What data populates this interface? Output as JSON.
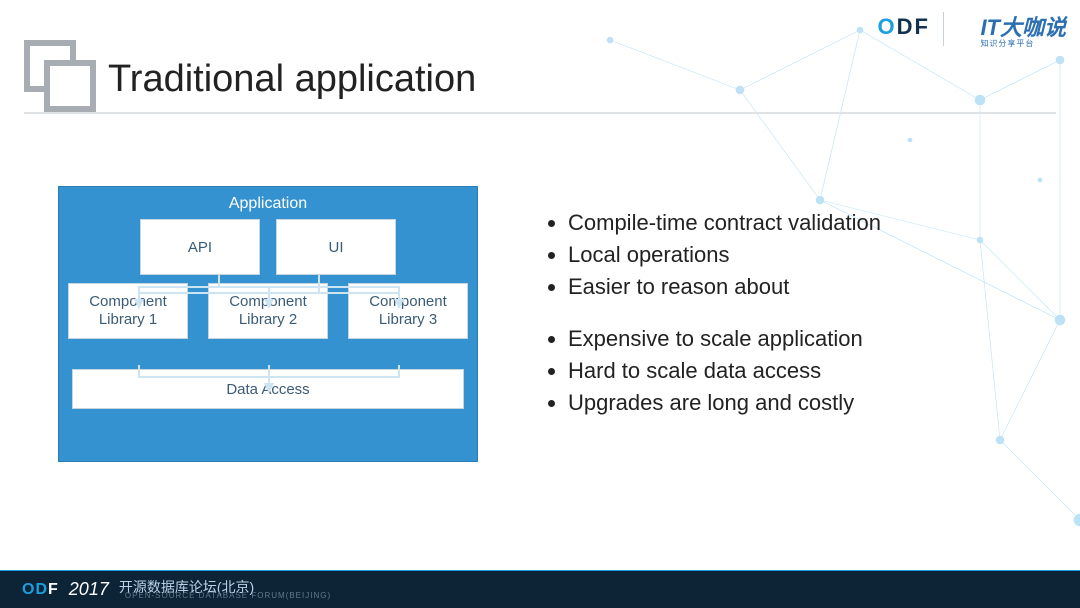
{
  "title": "Traditional application",
  "diagram": {
    "container_label": "Application",
    "top_row": [
      "API",
      "UI"
    ],
    "mid_row": [
      "Component Library 1",
      "Component Library 2",
      "Component Library 3"
    ],
    "bottom": "Data Access"
  },
  "bullets_group1": [
    "Compile-time contract validation",
    "Local operations",
    "Easier to reason about"
  ],
  "bullets_group2": [
    "Expensive to scale application",
    "Hard to scale data access",
    "Upgrades are long and costly"
  ],
  "footer": {
    "brand": "ODF",
    "year": "2017",
    "cn": "开源数据库论坛(北京)",
    "en": "OPEN-SOURCE DATABASE FORUM(BEIJING)"
  },
  "logos": {
    "odf": "ODF",
    "itdakashuo": "IT大咖说",
    "itdakashuo_sub": "知识分享平台"
  }
}
